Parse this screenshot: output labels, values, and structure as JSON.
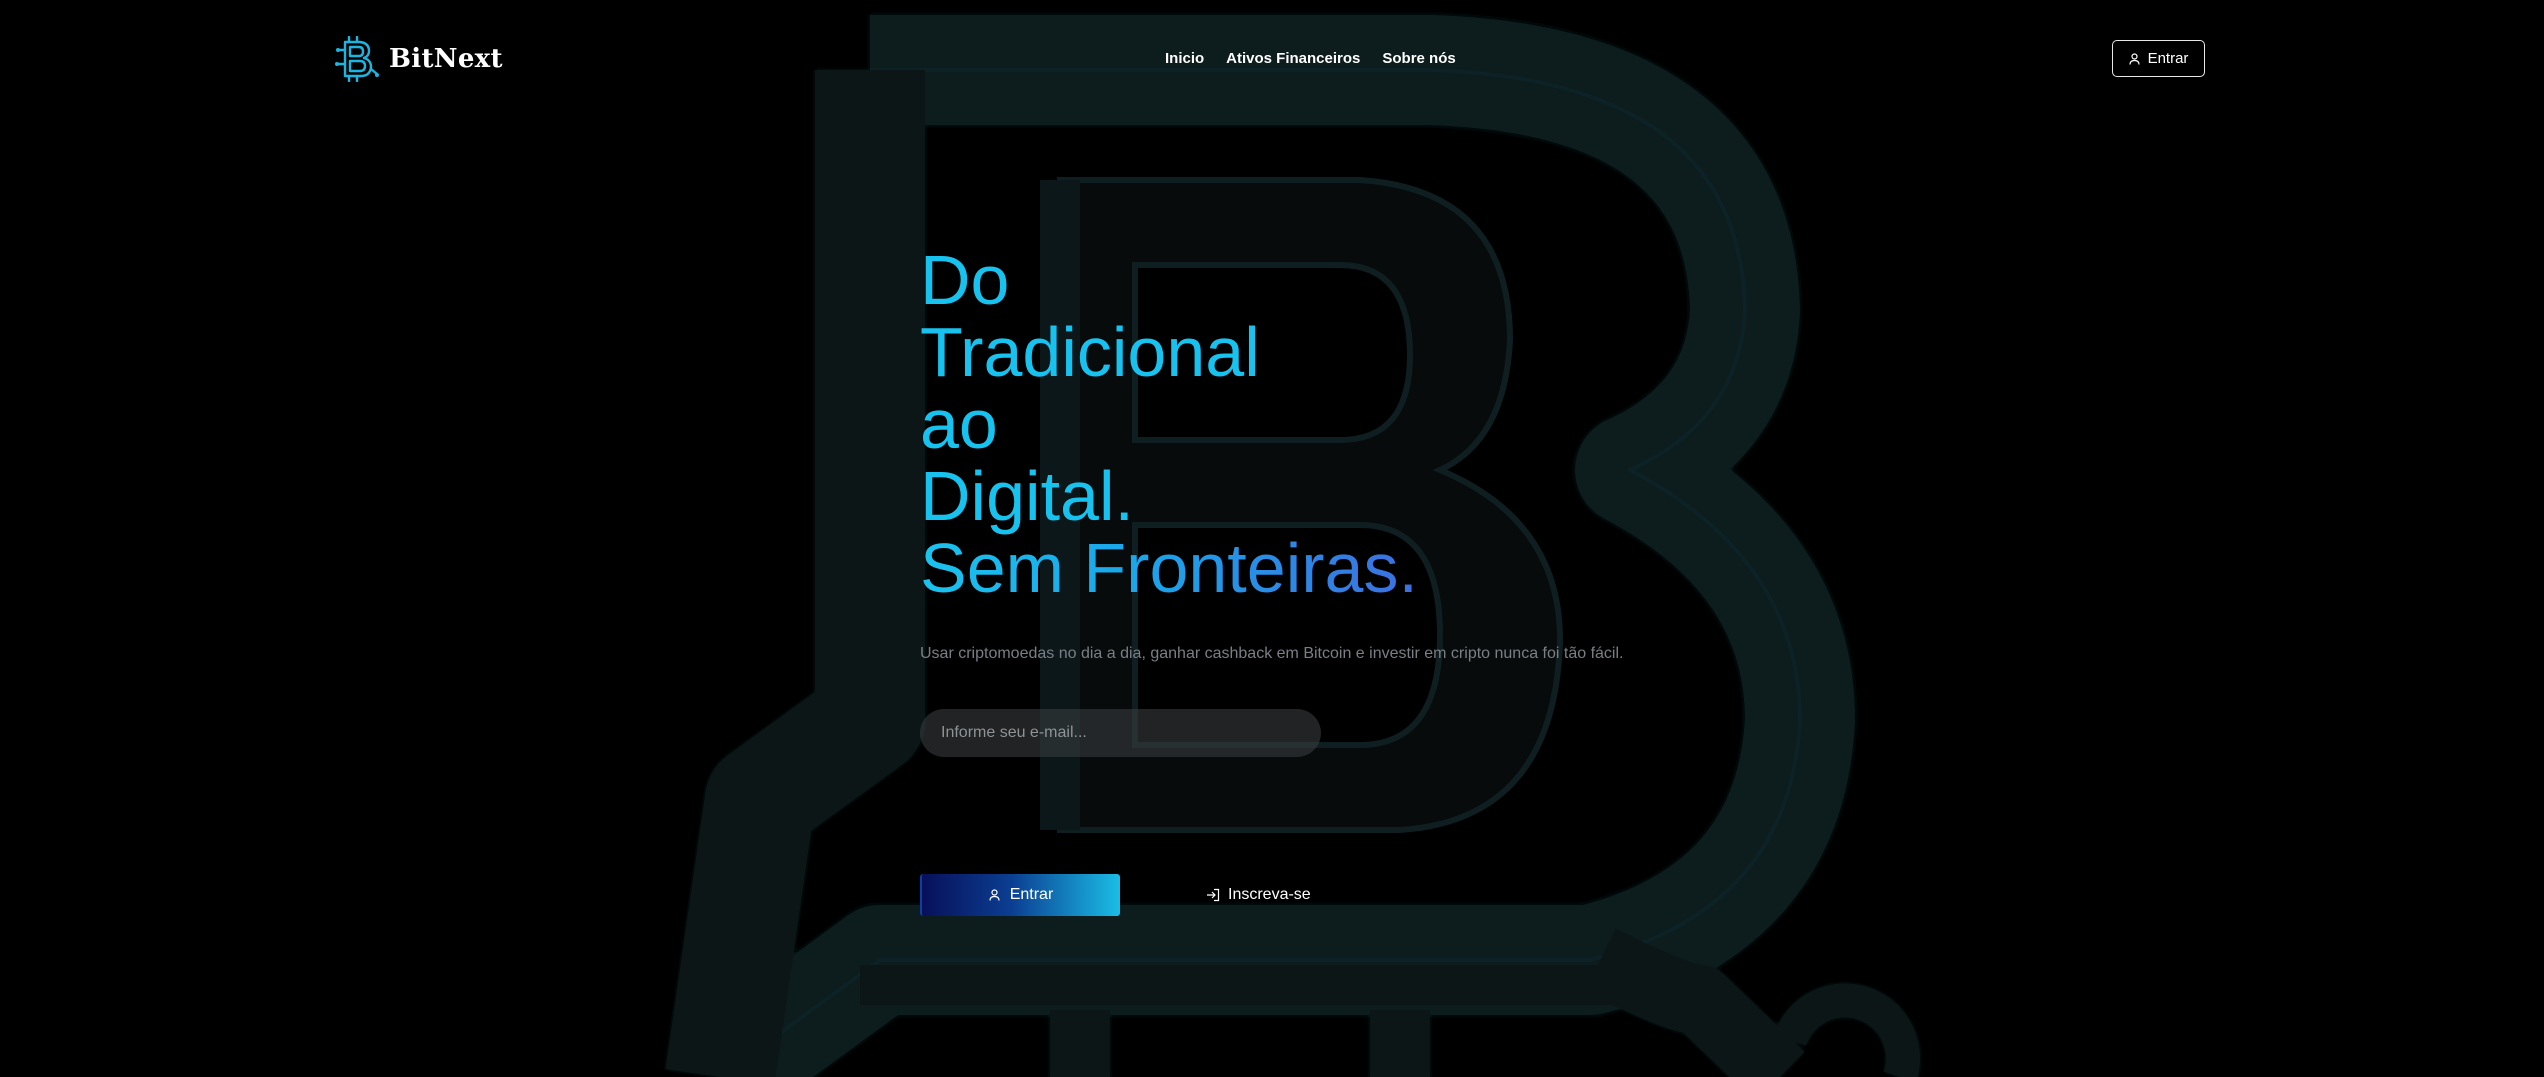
{
  "brand": {
    "name": "BitNext",
    "logo_icon": "bitcoin-b-circuit-icon",
    "accent_color": "#18c2ef"
  },
  "nav": {
    "items": [
      {
        "label": "Inicio"
      },
      {
        "label": "Ativos Financeiros"
      },
      {
        "label": "Sobre nós"
      }
    ]
  },
  "header": {
    "login_label": "Entrar",
    "login_icon": "user-icon"
  },
  "hero": {
    "title_lines": [
      "Do",
      "Tradicional",
      "ao",
      "Digital.",
      "Sem Fronteiras."
    ],
    "subtitle": "Usar criptomoedas no dia a dia, ganhar cashback em Bitcoin e investir em cripto nunca foi tão fácil.",
    "email_placeholder": "Informe seu e-mail...",
    "login_button": "Entrar",
    "login_icon": "user-icon",
    "signup_button": "Inscreva-se",
    "signup_icon": "sign-in-icon",
    "gradient_colors": [
      "#08105a",
      "#0b3e91",
      "#1bbde6"
    ]
  },
  "background": {
    "watermark_icon": "bitcoin-b-watermark-icon",
    "color": "#000000"
  }
}
